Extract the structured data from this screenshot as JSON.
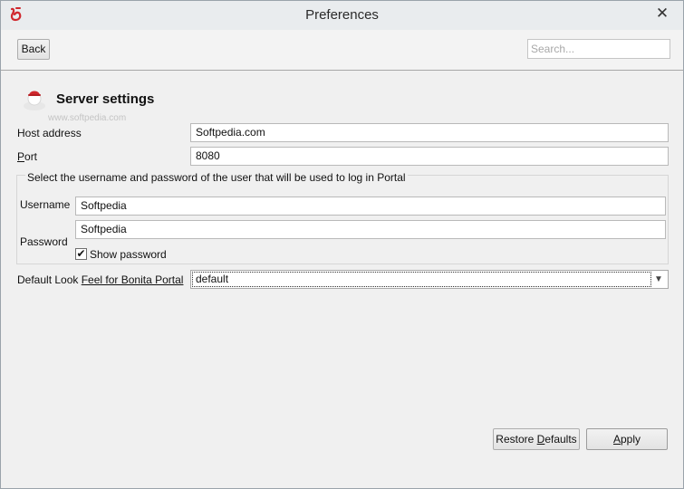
{
  "window": {
    "title": "Preferences",
    "close_glyph": "✕"
  },
  "toolbar": {
    "back_label": "Back",
    "search_placeholder": "Search..."
  },
  "section": {
    "title": "Server settings",
    "watermark": "www.softpedia.com"
  },
  "form": {
    "host_label": "Host address",
    "host_value": "Softpedia.com",
    "port_label_first": "P",
    "port_label_rest": "ort",
    "port_value": "8080",
    "credentials_group_title": "Select the username and password of the user that will be used to log in Portal",
    "username_label": "Username",
    "username_value": "Softpedia",
    "password_label": "Password",
    "password_value": "Softpedia",
    "show_password_label": "Show password",
    "show_password_checked": true,
    "checkbox_glyph": "✔",
    "look_feel_label_a": "Default Look ",
    "look_feel_label_b": "Feel for Bonita Portal",
    "look_feel_value": "default",
    "dropdown_glyph": "▼"
  },
  "footer": {
    "restore_label_a": "Restore ",
    "restore_label_d": "D",
    "restore_label_b": "efaults",
    "apply_label_a": "A",
    "apply_label_b": "pply"
  },
  "colors": {
    "accent": "#d0282e"
  }
}
